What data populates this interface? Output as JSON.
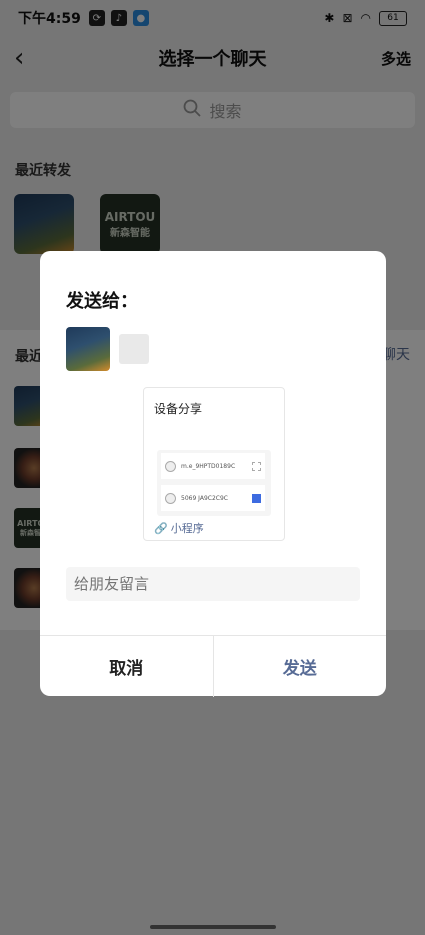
{
  "status_bar": {
    "time": "下午4:59",
    "battery": "61"
  },
  "nav": {
    "title": "选择一个聊天",
    "multi_select": "多选"
  },
  "search": {
    "placeholder": "搜索"
  },
  "sections": {
    "recent_forward": "最近转发",
    "recent_chats": "最近",
    "side_link": "聊天"
  },
  "recent_forward_items": [
    {
      "label": ""
    },
    {
      "label": "",
      "logo_line1": "AIRTOU",
      "logo_line2": "新森智能"
    }
  ],
  "list_logo": {
    "line1": "AIRTOU",
    "line2": "新森智能"
  },
  "dialog": {
    "title": "发送给：",
    "card": {
      "title": "设备分享",
      "devices": [
        {
          "name": "m.e_9HPTD0189C",
          "checked": false
        },
        {
          "name": "5069 JA9C2C9C",
          "checked": true
        }
      ],
      "footer": "小程序"
    },
    "message_placeholder": "给朋友留言",
    "cancel": "取消",
    "send": "发送"
  }
}
